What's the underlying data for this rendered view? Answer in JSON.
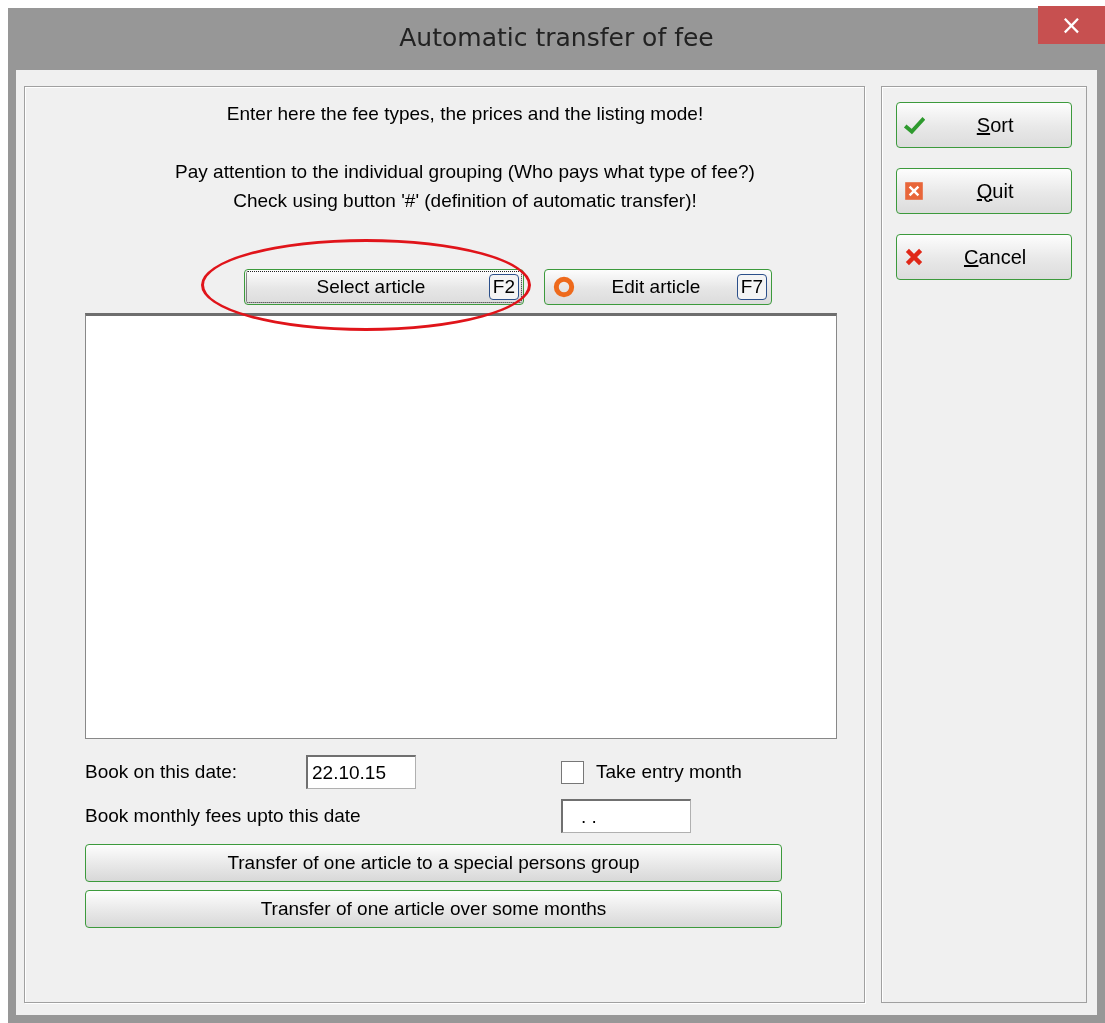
{
  "window": {
    "title": "Automatic transfer of fee",
    "close": "×"
  },
  "instructions": [
    [
      "Enter here the fee types, the prices and the listing mode!"
    ],
    [
      "Pay attention to the individual grouping (Who pays what type of fee?)",
      "Check using button '#' (definition of automatic transfer)!"
    ]
  ],
  "article_buttons": [
    {
      "kind": "plain",
      "label": "Select article",
      "key": "F2",
      "focused": true
    },
    {
      "kind": "ring",
      "label": "Edit article",
      "key": "F7",
      "focused": false
    }
  ],
  "annotation": {
    "kind": "ellipse"
  },
  "book_date": {
    "label": "Book on this date:",
    "value": "22.10.15"
  },
  "take_entry_month": {
    "label": "Take entry month",
    "checked": false
  },
  "monthly_date": {
    "label": "Book monthly fees upto this date",
    "value": ". ."
  },
  "transfer_buttons": [
    "Transfer of one article to a special persons group",
    "Transfer of one article over some months"
  ],
  "side_buttons": [
    {
      "kind": "check",
      "accel": "S",
      "rest": "ort"
    },
    {
      "kind": "square-x",
      "accel": "Q",
      "rest": "uit"
    },
    {
      "kind": "x",
      "accel": "C",
      "rest": "ancel"
    }
  ]
}
